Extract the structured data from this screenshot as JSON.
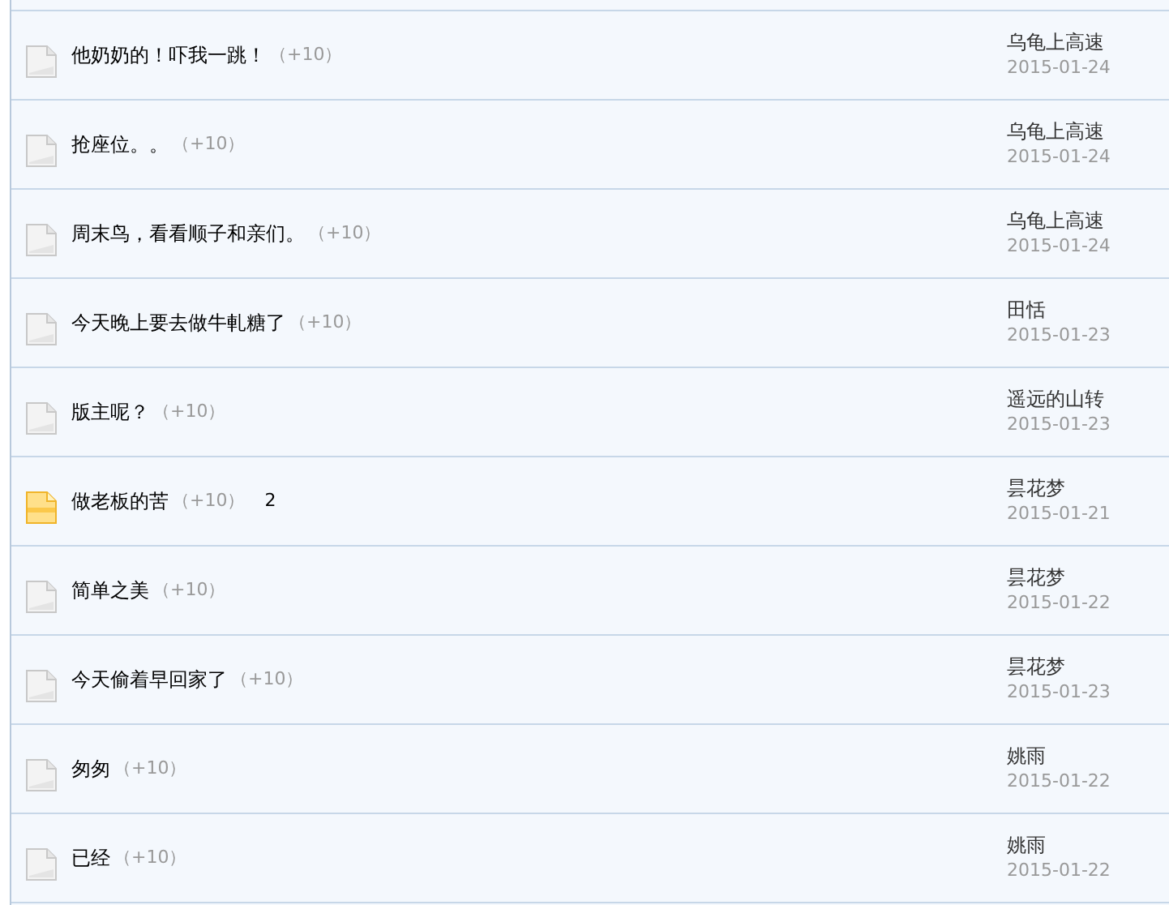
{
  "threads": [
    {
      "kind": "normal",
      "title": "他奶奶的！吓我一跳！",
      "bonus": "（+10）",
      "author": "乌龟上高速",
      "date": "2015-01-24"
    },
    {
      "kind": "normal",
      "title": "抢座位。。",
      "bonus": "（+10）",
      "author": "乌龟上高速",
      "date": "2015-01-24"
    },
    {
      "kind": "normal",
      "title": "周末鸟，看看顺子和亲们。",
      "bonus": "（+10）",
      "author": "乌龟上高速",
      "date": "2015-01-24"
    },
    {
      "kind": "normal",
      "title": "今天晚上要去做牛軋糖了",
      "bonus": "（+10）",
      "author": "田恬",
      "date": "2015-01-23"
    },
    {
      "kind": "normal",
      "title": "版主呢？",
      "bonus": "（+10）",
      "author": "遥远的山转",
      "date": "2015-01-23"
    },
    {
      "kind": "hot",
      "title": "做老板的苦",
      "bonus": "（+10）",
      "replies": "2",
      "author": "昙花梦",
      "date": "2015-01-21"
    },
    {
      "kind": "normal",
      "title": "简单之美",
      "bonus": "（+10）",
      "author": "昙花梦",
      "date": "2015-01-22"
    },
    {
      "kind": "normal",
      "title": "今天偷着早回家了",
      "bonus": "（+10）",
      "author": "昙花梦",
      "date": "2015-01-23"
    },
    {
      "kind": "normal",
      "title": "匆匆",
      "bonus": "（+10）",
      "author": "姚雨",
      "date": "2015-01-22"
    },
    {
      "kind": "normal",
      "title": "已经",
      "bonus": "（+10）",
      "author": "姚雨",
      "date": "2015-01-22"
    }
  ]
}
